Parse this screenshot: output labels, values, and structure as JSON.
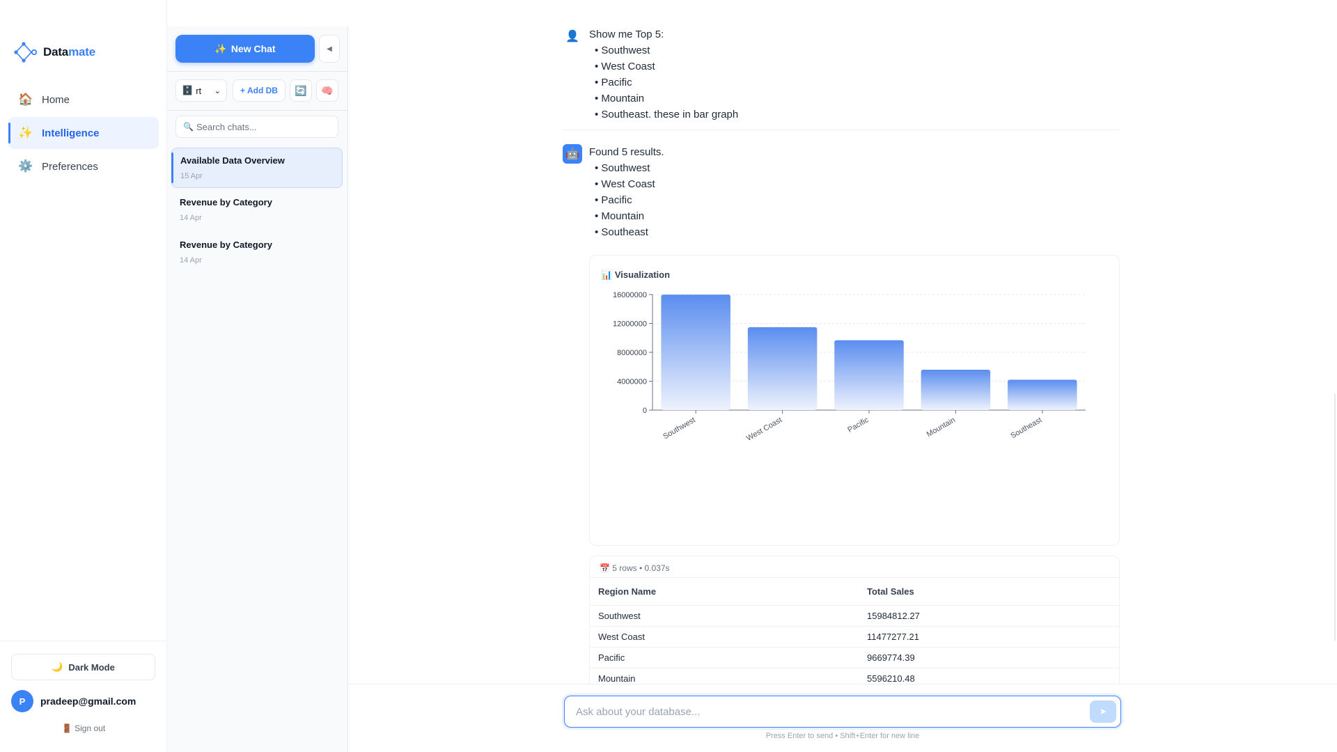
{
  "brand": {
    "name_part1": "Data",
    "name_part2": "mate"
  },
  "nav": {
    "items": [
      {
        "label": "Home",
        "icon": "🏠"
      },
      {
        "label": "Intelligence",
        "icon": "✨"
      },
      {
        "label": "Preferences",
        "icon": "⚙️"
      }
    ],
    "dark_mode_icon": "🌙",
    "dark_mode_label": "Dark Mode",
    "user": {
      "initial": "P",
      "email": "pradeep@gmail.com"
    },
    "signout_icon": "🚪",
    "signout_label": "Sign out"
  },
  "chatbar": {
    "new_chat_icon": "✨",
    "new_chat_label": "New Chat",
    "collapse_icon": "◀",
    "db_icon": "🗄️",
    "db_value": "rt",
    "db_chevron": "⌄",
    "add_db_label": "+ Add DB",
    "refresh_icon": "🔄",
    "memory_icon": "🧠",
    "search_icon": "🔍",
    "search_placeholder": "Search chats...",
    "chats": [
      {
        "title": "Available Data Overview",
        "date": "15 Apr"
      },
      {
        "title": "Revenue by Category",
        "date": "14 Apr"
      },
      {
        "title": "Revenue by Category",
        "date": "14 Apr"
      }
    ]
  },
  "messages": {
    "user": {
      "avatar_icon": "👤",
      "intro": "Show me Top 5:",
      "items": [
        "Southwest",
        "West Coast",
        "Pacific",
        "Mountain",
        "Southeast. these in bar graph"
      ]
    },
    "bot": {
      "avatar_icon": "🤖",
      "intro": "Found 5 results.",
      "items": [
        "Southwest",
        "West Coast",
        "Pacific",
        "Mountain",
        "Southeast"
      ]
    }
  },
  "viz": {
    "icon": "📊",
    "title": "Visualization"
  },
  "chart_data": {
    "type": "bar",
    "categories": [
      "Southwest",
      "West Coast",
      "Pacific",
      "Mountain",
      "Southeast"
    ],
    "values": [
      15984812.27,
      11477277.21,
      9669774.39,
      5596210.48,
      4200000
    ],
    "yticks": [
      "0",
      "4000000",
      "8000000",
      "12000000",
      "16000000"
    ],
    "ylim": [
      0,
      16000000
    ],
    "grid": true,
    "bar_color_top": "#5b8def",
    "bar_color_bottom": "#eef3fd"
  },
  "table": {
    "meta_icon": "📅",
    "meta": "5 rows • 0.037s",
    "columns": [
      "Region Name",
      "Total Sales"
    ],
    "rows": [
      [
        "Southwest",
        "15984812.27"
      ],
      [
        "West Coast",
        "11477277.21"
      ],
      [
        "Pacific",
        "9669774.39"
      ],
      [
        "Mountain",
        "5596210.48"
      ]
    ]
  },
  "composer": {
    "placeholder": "Ask about your database...",
    "send_icon": "➤",
    "hint": "Press Enter to send • Shift+Enter for new line"
  },
  "colors": {
    "accent": "#3b82f6",
    "active_bg": "#eef4ff"
  }
}
